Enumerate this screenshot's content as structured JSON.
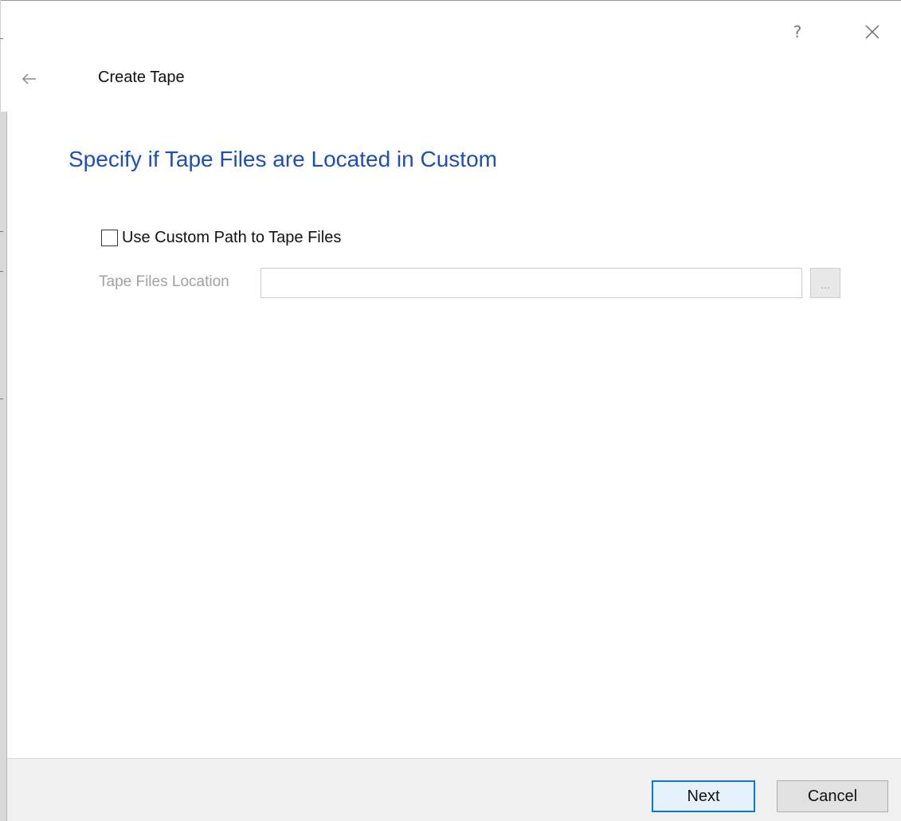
{
  "window": {
    "title": "Create Tape",
    "help_glyph": "?",
    "icons": [
      "help-icon",
      "close-icon",
      "back-arrow-icon"
    ]
  },
  "page": {
    "heading": "Specify if Tape Files are Located in Custom"
  },
  "custom_path": {
    "checkbox_label": "Use Custom Path to Tape Files",
    "checked": false,
    "location_label": "Tape Files Location",
    "location_value": "",
    "browse_label": "...",
    "enabled": false
  },
  "footer": {
    "next_label": "Next",
    "cancel_label": "Cancel"
  },
  "colors": {
    "heading": "#1f4fb5",
    "disabled_text": "#a2a2a2",
    "default_button_border": "#0a78d7"
  }
}
